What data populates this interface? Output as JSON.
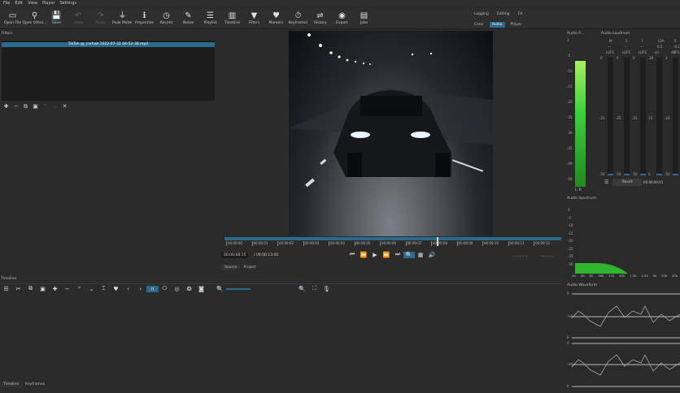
{
  "menu": [
    "File",
    "Edit",
    "View",
    "Player",
    "Settings"
  ],
  "toolbar": [
    {
      "label": "Open File",
      "icon": "folder-icon",
      "glyph": "▭",
      "dim": false
    },
    {
      "label": "Open Other...",
      "icon": "open-other-icon",
      "glyph": "⚲",
      "dim": false
    },
    {
      "label": "Save",
      "icon": "save-icon",
      "glyph": "💾",
      "dim": false
    },
    {
      "label": "Undo",
      "icon": "undo-icon",
      "glyph": "↶",
      "dim": true
    },
    {
      "label": "Redo",
      "icon": "redo-icon",
      "glyph": "↷",
      "dim": true
    },
    {
      "label": "Peak Meter",
      "icon": "peak-meter-icon",
      "glyph": "⏚",
      "dim": false
    },
    {
      "label": "Properties",
      "icon": "properties-icon",
      "glyph": "ℹ",
      "dim": false
    },
    {
      "label": "Recent",
      "icon": "clock-icon",
      "glyph": "◷",
      "dim": false
    },
    {
      "label": "Notes",
      "icon": "notes-icon",
      "glyph": "✎",
      "dim": false
    },
    {
      "label": "Playlist",
      "icon": "playlist-icon",
      "glyph": "☰",
      "dim": false
    },
    {
      "label": "Timeline",
      "icon": "timeline-icon",
      "glyph": "▥",
      "dim": false
    },
    {
      "label": "Filters",
      "icon": "filter-icon",
      "glyph": "▼",
      "dim": false
    },
    {
      "label": "Markers",
      "icon": "marker-icon",
      "glyph": "♥",
      "dim": false
    },
    {
      "label": "Keyframes",
      "icon": "stopwatch-icon",
      "glyph": "⏱",
      "dim": false
    },
    {
      "label": "History",
      "icon": "history-icon",
      "glyph": "⇌",
      "dim": false
    },
    {
      "label": "Export",
      "icon": "export-icon",
      "glyph": "◉",
      "dim": false
    },
    {
      "label": "Jobs",
      "icon": "jobs-icon",
      "glyph": "▤",
      "dim": false
    }
  ],
  "workspaces": {
    "row1": [
      "Logging",
      "Editing",
      "FX"
    ],
    "row2": [
      "Color",
      "Audio",
      "Player"
    ],
    "active": "Audio"
  },
  "filters": {
    "title": "Filters",
    "clip": "TikTok @_carhub 2022-07-31 04-52-38.mp4"
  },
  "player": {
    "ticks": [
      "00:00:00",
      "00:00:01",
      "00:00:02",
      "00:00:03",
      "00:00:04",
      "00:00:05",
      "00:00:06",
      "00:00:07",
      "00:00:08",
      "00:00:09",
      "00:00:10",
      "00:00:11",
      "00:00:12"
    ],
    "position": "00:00:08:15",
    "duration": "/ 00:00:13:00",
    "in_out_left": "--:--:--:-- /",
    "in_out_right": "--:--:--:--",
    "tabs": [
      "Source",
      "Project"
    ],
    "playhead_fraction": 0.63
  },
  "audio_peak": {
    "title": "Audio P...",
    "scale": [
      "3",
      "-5",
      "-10",
      "-15",
      "-20",
      "-25",
      "-30",
      "-35",
      "-40",
      "-50"
    ],
    "channels": [
      "L",
      "R"
    ],
    "level_fraction": 0.9
  },
  "loudness": {
    "title": "Audio Loudness",
    "cols": [
      {
        "k": "M",
        "v": "--",
        "u": "LUFS",
        "top": "0",
        "mid": "-25",
        "bot": "-50"
      },
      {
        "k": "S",
        "v": "--",
        "u": "LUFS",
        "top": "0",
        "mid": "-25",
        "bot": "-50"
      },
      {
        "k": "I",
        "v": "--",
        "u": "LUFS",
        "top": "0",
        "mid": "-25",
        "bot": "-50"
      },
      {
        "k": "LRA",
        "v": "0.0",
        "u": "LU",
        "top": "30",
        "mid": "15",
        "bot": "0"
      },
      {
        "k": "P",
        "v": "-0.1",
        "u": "dBFS",
        "top": "3",
        "mid": "-24",
        "bot": "-50"
      }
    ],
    "reset": "Reset",
    "time": "00:00:00:01"
  },
  "spectrum": {
    "title": "Audio Spectrum",
    "scale": [
      "3",
      "-5",
      "-10",
      "-15",
      "-20",
      "-25",
      "-35",
      "-50"
    ],
    "freqs": [
      "20",
      "40",
      "80",
      "160",
      "315",
      "630",
      "1.3k",
      "2.5k",
      "5k",
      "10k",
      "20k"
    ]
  },
  "waveform": {
    "title": "Audio Waveform",
    "labels": [
      "0",
      "-inf",
      "0",
      "0",
      "-inf",
      "0"
    ]
  },
  "timeline": {
    "title": "Timeline",
    "tabs": [
      "Timeline",
      "Keyframes"
    ]
  },
  "colors": {
    "accent": "#2b6a8a",
    "meter": "#3cd23c"
  }
}
